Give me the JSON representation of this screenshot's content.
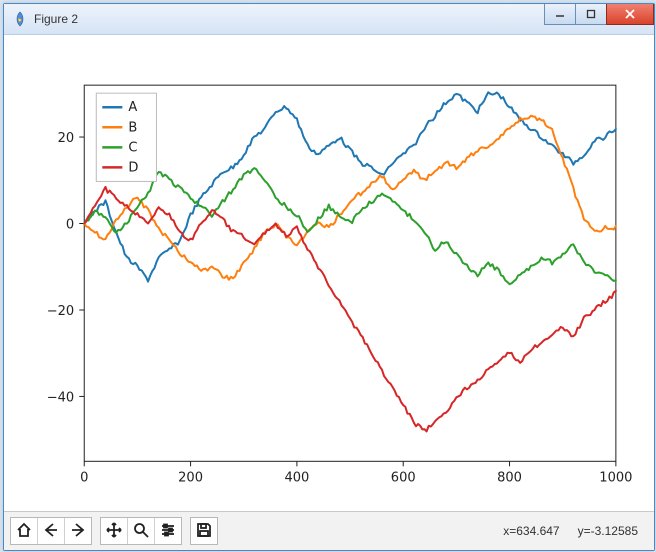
{
  "window": {
    "title": "Figure 2"
  },
  "status": {
    "x_label": "x=634.647",
    "y_label": "y=-3.12585"
  },
  "toolbar": {
    "home": "Home",
    "back": "Back",
    "forward": "Forward",
    "pan": "Pan",
    "zoom": "Zoom",
    "configure": "Configure subplots",
    "save": "Save"
  },
  "legend": {
    "items": [
      {
        "label": "A",
        "color": "#1f77b4"
      },
      {
        "label": "B",
        "color": "#ff7f0e"
      },
      {
        "label": "C",
        "color": "#2ca02c"
      },
      {
        "label": "D",
        "color": "#d62728"
      }
    ]
  },
  "axes": {
    "x_ticks": [
      "0",
      "200",
      "400",
      "600",
      "800",
      "1000"
    ],
    "y_ticks": [
      "-40",
      "-20",
      "0",
      "20"
    ]
  },
  "chart_data": {
    "type": "line",
    "xlabel": "",
    "ylabel": "",
    "title": "",
    "xlim": [
      0,
      1000
    ],
    "ylim": [
      -55,
      32
    ],
    "x": [
      0,
      20,
      40,
      60,
      80,
      100,
      120,
      140,
      160,
      180,
      200,
      220,
      240,
      260,
      280,
      300,
      320,
      340,
      360,
      380,
      400,
      420,
      440,
      460,
      480,
      500,
      520,
      540,
      560,
      580,
      600,
      620,
      640,
      660,
      680,
      700,
      720,
      740,
      760,
      780,
      800,
      820,
      840,
      860,
      880,
      900,
      920,
      940,
      960,
      980,
      1000
    ],
    "series": [
      {
        "name": "A",
        "color": "#1f77b4",
        "values": [
          0,
          3,
          5,
          -2,
          -8,
          -10,
          -13,
          -8,
          -6,
          -4,
          2,
          6,
          9,
          12,
          13,
          16,
          20,
          22,
          26,
          27,
          24,
          18,
          16,
          18,
          20,
          17,
          14,
          13,
          11,
          14,
          16,
          18,
          22,
          25,
          28,
          30,
          28,
          26,
          30,
          30,
          27,
          24,
          22,
          20,
          18,
          16,
          14,
          16,
          19,
          20,
          22
        ]
      },
      {
        "name": "B",
        "color": "#ff7f0e",
        "values": [
          0,
          -2,
          -4,
          1,
          4,
          6,
          3,
          -1,
          -4,
          -7,
          -9,
          -11,
          -10,
          -12,
          -13,
          -9,
          -6,
          -2,
          0,
          -3,
          -5,
          -2,
          0,
          -1,
          2,
          5,
          7,
          9,
          11,
          8,
          10,
          12,
          10,
          12,
          14,
          13,
          15,
          17,
          18,
          20,
          22,
          24,
          25,
          24,
          22,
          15,
          8,
          1,
          -2,
          -1,
          -1
        ]
      },
      {
        "name": "C",
        "color": "#2ca02c",
        "values": [
          0,
          3,
          1,
          -2,
          0,
          4,
          7,
          12,
          10,
          8,
          6,
          4,
          2,
          5,
          8,
          11,
          13,
          10,
          6,
          4,
          2,
          -2,
          1,
          4,
          2,
          0,
          3,
          5,
          7,
          5,
          3,
          1,
          -2,
          -6,
          -4,
          -7,
          -10,
          -12,
          -9,
          -11,
          -14,
          -12,
          -10,
          -8,
          -9,
          -7,
          -5,
          -9,
          -11,
          -12,
          -13
        ]
      },
      {
        "name": "D",
        "color": "#d62728",
        "values": [
          0,
          4,
          8,
          6,
          4,
          2,
          0,
          4,
          2,
          -2,
          -4,
          0,
          3,
          1,
          -2,
          -3,
          -5,
          -2,
          0,
          -3,
          -1,
          -6,
          -10,
          -14,
          -18,
          -22,
          -26,
          -30,
          -34,
          -38,
          -42,
          -46,
          -48,
          -46,
          -44,
          -40,
          -38,
          -36,
          -34,
          -32,
          -30,
          -32,
          -29,
          -28,
          -26,
          -24,
          -26,
          -22,
          -20,
          -18,
          -16
        ]
      }
    ]
  }
}
